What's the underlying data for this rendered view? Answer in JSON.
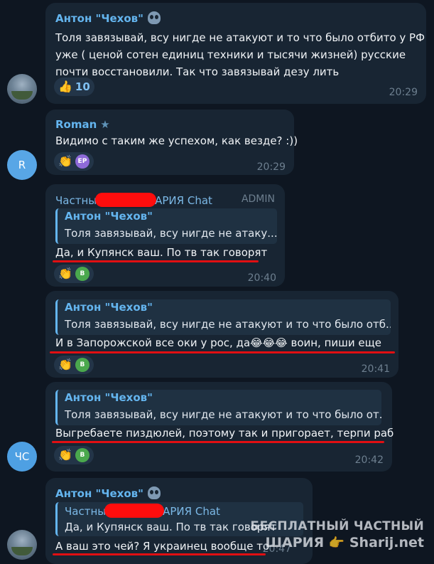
{
  "colors": {
    "accent": "#64b5ef",
    "background": "#0e1621",
    "bubble": "#182533",
    "underline": "#e10f12"
  },
  "messages": [
    {
      "author": "Антон \"Чехов\"",
      "lines": [
        "Толя завязывай, всу нигде не атакуют и то что было отбито у РФ",
        "уже ( ценой сотен единиц техники и тысячи жизней) русские",
        "почти восстановили. Так что завязывай дезу лить"
      ],
      "reaction_emoji": "👍",
      "reaction_count": "10",
      "time": "20:29"
    },
    {
      "author": "Roman",
      "text": "Видимо с таким же успехом, как везде? :))",
      "reaction_emoji": "👏",
      "reaction_user": "EP",
      "time": "20:29",
      "avatar": "R"
    },
    {
      "author_start": "Частны",
      "author_end": "АРИЯ Chat",
      "badge": "ADMIN",
      "quote_author": "Антон \"Чехов\"",
      "quote_text": "Толя завязывай, всу нигде не атаку...",
      "text": "Да, и Купянск ваш. По тв так говорят",
      "reaction_emoji": "👏",
      "reaction_user": "B",
      "time": "20:40"
    },
    {
      "quote_author": "Антон \"Чехов\"",
      "quote_text": "Толя завязывай, всу нигде не атакуют и то что было отб...",
      "text": "И в Запорожской все оки у рос, да😂😂😂 воин, пиши еще",
      "reaction_emoji": "👏",
      "reaction_user": "B",
      "time": "20:41"
    },
    {
      "quote_author": "Антон \"Чехов\"",
      "quote_text": "Толя завязывай, всу нигде не атакуют и то что было от...",
      "text": "Выгребаете пиздюлей, поэтому так и пригорает, терпи раб",
      "reaction_emoji": "👏",
      "reaction_user": "B",
      "time": "20:42",
      "avatar": "ЧС"
    },
    {
      "author": "Антон \"Чехов\"",
      "quote_author_start": "Частны",
      "quote_author_end": "АРИЯ Chat",
      "quote_text": "Да, и Купянск ваш. По тв так говорят",
      "text": "А ваш это чей? Я украинец вообще то",
      "time": "20:47"
    }
  ],
  "watermark": {
    "line1": "БЕСПЛАТНЫЙ ЧАСТНЫЙ",
    "line2_a": "ШАРИЯ",
    "line2_b": "Sharij.net"
  }
}
